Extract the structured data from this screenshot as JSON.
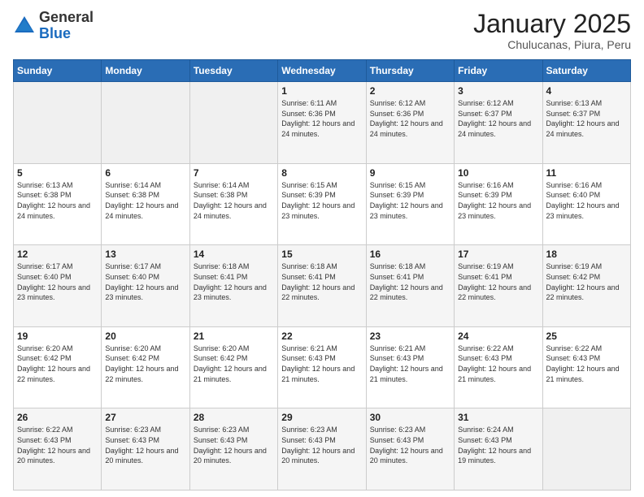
{
  "logo": {
    "general": "General",
    "blue": "Blue"
  },
  "header": {
    "month": "January 2025",
    "location": "Chulucanas, Piura, Peru"
  },
  "days_of_week": [
    "Sunday",
    "Monday",
    "Tuesday",
    "Wednesday",
    "Thursday",
    "Friday",
    "Saturday"
  ],
  "weeks": [
    [
      {
        "day": "",
        "sunrise": "",
        "sunset": "",
        "daylight": ""
      },
      {
        "day": "",
        "sunrise": "",
        "sunset": "",
        "daylight": ""
      },
      {
        "day": "",
        "sunrise": "",
        "sunset": "",
        "daylight": ""
      },
      {
        "day": "1",
        "sunrise": "Sunrise: 6:11 AM",
        "sunset": "Sunset: 6:36 PM",
        "daylight": "Daylight: 12 hours and 24 minutes."
      },
      {
        "day": "2",
        "sunrise": "Sunrise: 6:12 AM",
        "sunset": "Sunset: 6:36 PM",
        "daylight": "Daylight: 12 hours and 24 minutes."
      },
      {
        "day": "3",
        "sunrise": "Sunrise: 6:12 AM",
        "sunset": "Sunset: 6:37 PM",
        "daylight": "Daylight: 12 hours and 24 minutes."
      },
      {
        "day": "4",
        "sunrise": "Sunrise: 6:13 AM",
        "sunset": "Sunset: 6:37 PM",
        "daylight": "Daylight: 12 hours and 24 minutes."
      }
    ],
    [
      {
        "day": "5",
        "sunrise": "Sunrise: 6:13 AM",
        "sunset": "Sunset: 6:38 PM",
        "daylight": "Daylight: 12 hours and 24 minutes."
      },
      {
        "day": "6",
        "sunrise": "Sunrise: 6:14 AM",
        "sunset": "Sunset: 6:38 PM",
        "daylight": "Daylight: 12 hours and 24 minutes."
      },
      {
        "day": "7",
        "sunrise": "Sunrise: 6:14 AM",
        "sunset": "Sunset: 6:38 PM",
        "daylight": "Daylight: 12 hours and 24 minutes."
      },
      {
        "day": "8",
        "sunrise": "Sunrise: 6:15 AM",
        "sunset": "Sunset: 6:39 PM",
        "daylight": "Daylight: 12 hours and 23 minutes."
      },
      {
        "day": "9",
        "sunrise": "Sunrise: 6:15 AM",
        "sunset": "Sunset: 6:39 PM",
        "daylight": "Daylight: 12 hours and 23 minutes."
      },
      {
        "day": "10",
        "sunrise": "Sunrise: 6:16 AM",
        "sunset": "Sunset: 6:39 PM",
        "daylight": "Daylight: 12 hours and 23 minutes."
      },
      {
        "day": "11",
        "sunrise": "Sunrise: 6:16 AM",
        "sunset": "Sunset: 6:40 PM",
        "daylight": "Daylight: 12 hours and 23 minutes."
      }
    ],
    [
      {
        "day": "12",
        "sunrise": "Sunrise: 6:17 AM",
        "sunset": "Sunset: 6:40 PM",
        "daylight": "Daylight: 12 hours and 23 minutes."
      },
      {
        "day": "13",
        "sunrise": "Sunrise: 6:17 AM",
        "sunset": "Sunset: 6:40 PM",
        "daylight": "Daylight: 12 hours and 23 minutes."
      },
      {
        "day": "14",
        "sunrise": "Sunrise: 6:18 AM",
        "sunset": "Sunset: 6:41 PM",
        "daylight": "Daylight: 12 hours and 23 minutes."
      },
      {
        "day": "15",
        "sunrise": "Sunrise: 6:18 AM",
        "sunset": "Sunset: 6:41 PM",
        "daylight": "Daylight: 12 hours and 22 minutes."
      },
      {
        "day": "16",
        "sunrise": "Sunrise: 6:18 AM",
        "sunset": "Sunset: 6:41 PM",
        "daylight": "Daylight: 12 hours and 22 minutes."
      },
      {
        "day": "17",
        "sunrise": "Sunrise: 6:19 AM",
        "sunset": "Sunset: 6:41 PM",
        "daylight": "Daylight: 12 hours and 22 minutes."
      },
      {
        "day": "18",
        "sunrise": "Sunrise: 6:19 AM",
        "sunset": "Sunset: 6:42 PM",
        "daylight": "Daylight: 12 hours and 22 minutes."
      }
    ],
    [
      {
        "day": "19",
        "sunrise": "Sunrise: 6:20 AM",
        "sunset": "Sunset: 6:42 PM",
        "daylight": "Daylight: 12 hours and 22 minutes."
      },
      {
        "day": "20",
        "sunrise": "Sunrise: 6:20 AM",
        "sunset": "Sunset: 6:42 PM",
        "daylight": "Daylight: 12 hours and 22 minutes."
      },
      {
        "day": "21",
        "sunrise": "Sunrise: 6:20 AM",
        "sunset": "Sunset: 6:42 PM",
        "daylight": "Daylight: 12 hours and 21 minutes."
      },
      {
        "day": "22",
        "sunrise": "Sunrise: 6:21 AM",
        "sunset": "Sunset: 6:43 PM",
        "daylight": "Daylight: 12 hours and 21 minutes."
      },
      {
        "day": "23",
        "sunrise": "Sunrise: 6:21 AM",
        "sunset": "Sunset: 6:43 PM",
        "daylight": "Daylight: 12 hours and 21 minutes."
      },
      {
        "day": "24",
        "sunrise": "Sunrise: 6:22 AM",
        "sunset": "Sunset: 6:43 PM",
        "daylight": "Daylight: 12 hours and 21 minutes."
      },
      {
        "day": "25",
        "sunrise": "Sunrise: 6:22 AM",
        "sunset": "Sunset: 6:43 PM",
        "daylight": "Daylight: 12 hours and 21 minutes."
      }
    ],
    [
      {
        "day": "26",
        "sunrise": "Sunrise: 6:22 AM",
        "sunset": "Sunset: 6:43 PM",
        "daylight": "Daylight: 12 hours and 20 minutes."
      },
      {
        "day": "27",
        "sunrise": "Sunrise: 6:23 AM",
        "sunset": "Sunset: 6:43 PM",
        "daylight": "Daylight: 12 hours and 20 minutes."
      },
      {
        "day": "28",
        "sunrise": "Sunrise: 6:23 AM",
        "sunset": "Sunset: 6:43 PM",
        "daylight": "Daylight: 12 hours and 20 minutes."
      },
      {
        "day": "29",
        "sunrise": "Sunrise: 6:23 AM",
        "sunset": "Sunset: 6:43 PM",
        "daylight": "Daylight: 12 hours and 20 minutes."
      },
      {
        "day": "30",
        "sunrise": "Sunrise: 6:23 AM",
        "sunset": "Sunset: 6:43 PM",
        "daylight": "Daylight: 12 hours and 20 minutes."
      },
      {
        "day": "31",
        "sunrise": "Sunrise: 6:24 AM",
        "sunset": "Sunset: 6:43 PM",
        "daylight": "Daylight: 12 hours and 19 minutes."
      },
      {
        "day": "",
        "sunrise": "",
        "sunset": "",
        "daylight": ""
      }
    ]
  ]
}
